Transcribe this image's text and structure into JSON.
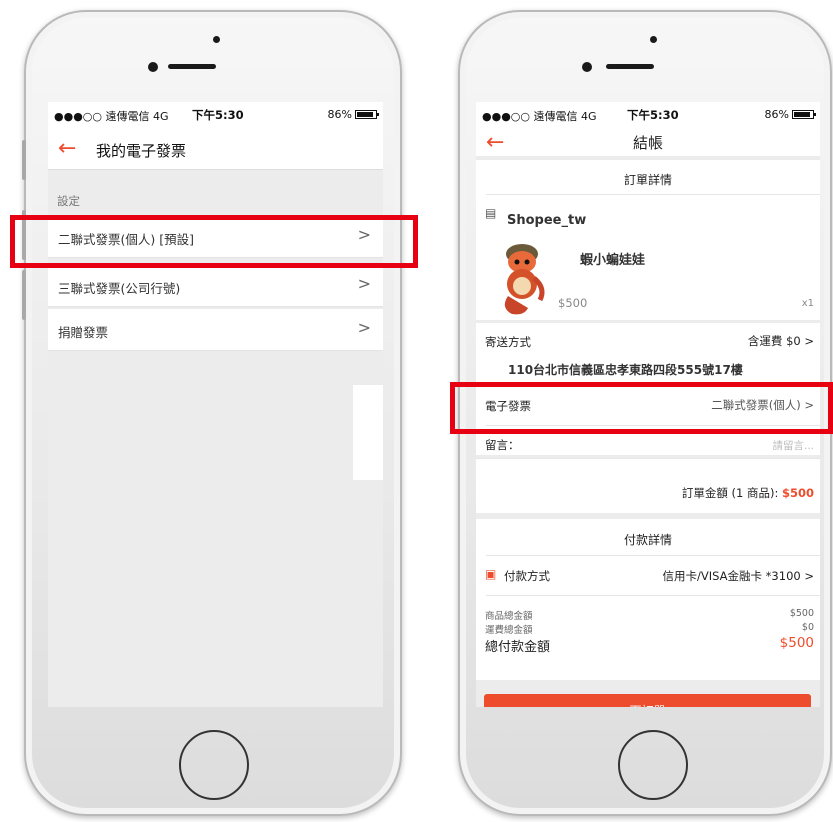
{
  "status_bar": {
    "carrier": "●●●○○ 遠傳電信  4G",
    "time": "下午5:30",
    "battery": "86%"
  },
  "left_screen": {
    "nav": {
      "back_icon": "arrow-left-icon",
      "title": "我的電子發票"
    },
    "section_label": "設定",
    "items": [
      {
        "label": "二聯式發票(個人)  [預設]",
        "chevron": ">"
      },
      {
        "label": "三聯式發票(公司行號)",
        "chevron": ">"
      },
      {
        "label": "捐贈發票",
        "chevron": ">"
      }
    ]
  },
  "right_screen": {
    "nav": {
      "back_icon": "arrow-left-icon",
      "title": "結帳"
    },
    "order_details_header": "訂單詳情",
    "shop": {
      "icon": "shop-icon",
      "name": "Shopee_tw"
    },
    "product": {
      "name": "蝦小蝙娃娃",
      "price": "$500",
      "quantity": "x1"
    },
    "shipping": {
      "label": "寄送方式",
      "fee_label": "含運費",
      "fee": "$0",
      "chevron": ">"
    },
    "address": "110台北市信義區忠孝東路四段555號17樓",
    "e_invoice": {
      "label": "電子發票",
      "value": "二聯式發票(個人)",
      "chevron": ">"
    },
    "message": {
      "label": "留言：",
      "placeholder": "請留言..."
    },
    "order_total": {
      "label": "訂單金額 (1 商品):",
      "value": "$500"
    },
    "payment_details_header": "付款詳情",
    "payment_method": {
      "icon": "credit-card-icon",
      "label": "付款方式",
      "value": "信用卡/VISA金融卡  *3100",
      "chevron": ">"
    },
    "summary": {
      "items_total_label": "商品總金額",
      "items_total": "$500",
      "shipping_total_label": "運費總金額",
      "shipping_total": "$0",
      "grand_total_label": "總付款金額",
      "grand_total": "$500"
    },
    "place_order_button": "下訂單"
  },
  "colors": {
    "accent": "#ee4d2d",
    "highlight": "#e60012",
    "background": "#ececec"
  }
}
